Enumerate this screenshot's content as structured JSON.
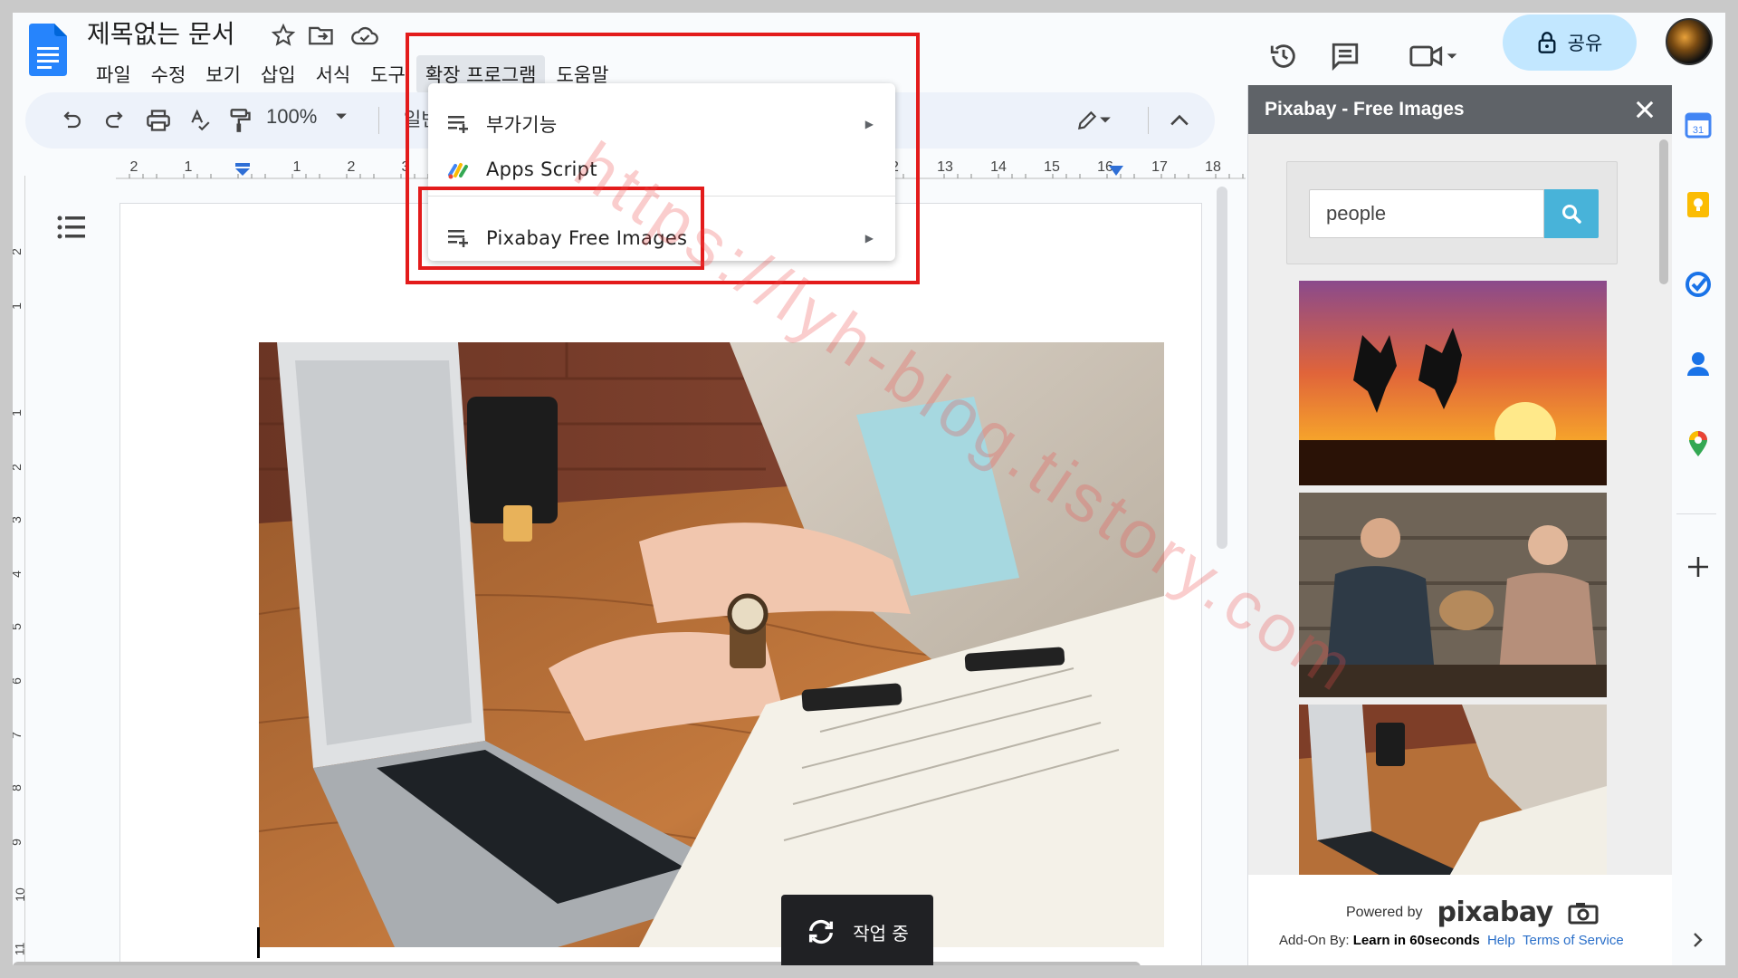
{
  "doc": {
    "title": "제목없는 문서"
  },
  "menubar": [
    "파일",
    "수정",
    "보기",
    "삽입",
    "서식",
    "도구",
    "확장 프로그램",
    "도움말"
  ],
  "header": {
    "share_label": "공유"
  },
  "toolbar": {
    "zoom": "100%",
    "style": "일반"
  },
  "ruler": {
    "marks": [
      "2",
      "1",
      "1",
      "2",
      "3",
      "12",
      "13",
      "14",
      "15",
      "16",
      "17",
      "18"
    ]
  },
  "vruler": {
    "marks": [
      "2",
      "1",
      "1",
      "2",
      "3",
      "4",
      "5",
      "6",
      "7",
      "8",
      "9",
      "10",
      "11"
    ]
  },
  "extensions_menu": {
    "items": [
      {
        "label": "부가기능",
        "has_submenu": true
      },
      {
        "label": "Apps Script",
        "has_submenu": false
      },
      {
        "label": "Pixabay Free Images",
        "has_submenu": true
      }
    ]
  },
  "panel": {
    "title": "Pixabay - Free Images",
    "search_value": "people",
    "powered_by": "Powered by",
    "brand": "pixabay",
    "addon_by": "Add-On By:",
    "learn_badge": "Learn in 60seconds",
    "help": "Help",
    "terms": "Terms of Service"
  },
  "toast": {
    "label": "작업 중"
  },
  "watermark": "https://lyh-blog.tistory.com",
  "colors": {
    "accent": "#c2e7ff",
    "search_button": "#48b3d9",
    "highlight_box": "#e31b1b",
    "panel_header": "#5f6368"
  }
}
